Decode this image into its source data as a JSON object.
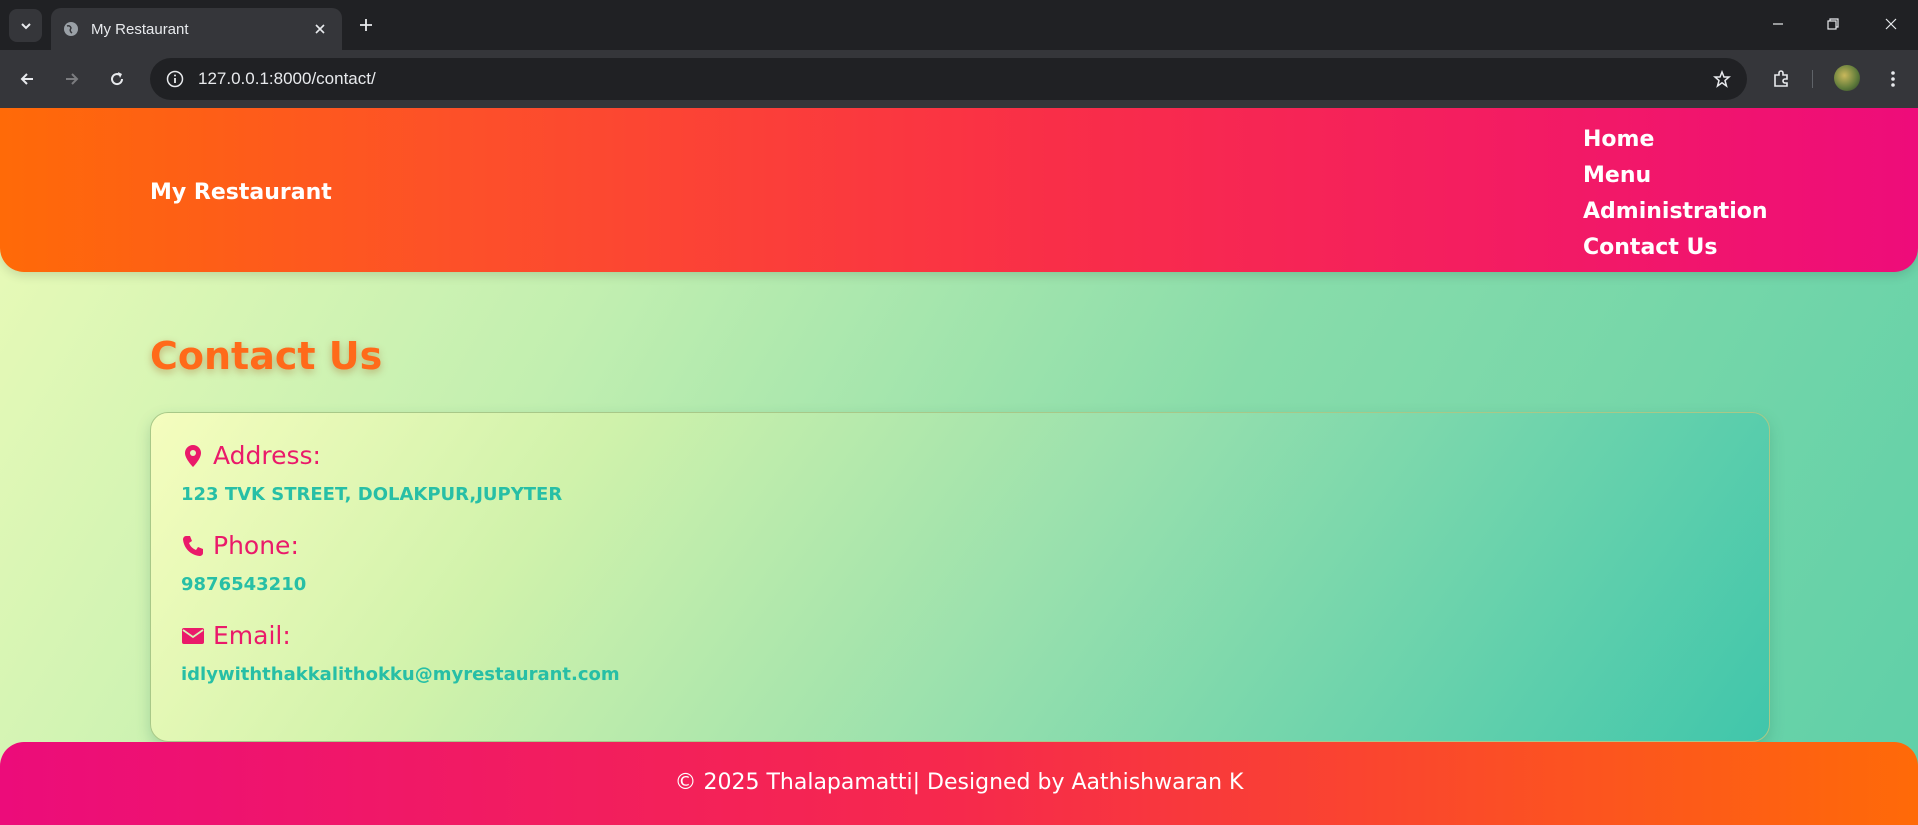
{
  "browser": {
    "tab_title": "My Restaurant",
    "url": "127.0.0.1:8000/contact/",
    "icons": [
      "tab-search-icon",
      "globe-icon",
      "close-icon",
      "plus-icon",
      "minimize-icon",
      "restore-icon",
      "close-window-icon",
      "back-icon",
      "forward-icon",
      "reload-icon",
      "info-icon",
      "star-icon",
      "extensions-icon",
      "profile-avatar",
      "more-icon"
    ]
  },
  "header": {
    "brand": "My Restaurant",
    "nav": [
      "Home",
      "Menu",
      "Administration",
      "Contact Us"
    ]
  },
  "main": {
    "title": "Contact Us",
    "address": {
      "label": "Address:",
      "value": "123 TVK STREET, DOLAKPUR,JUPYTER",
      "icon": "map-pin-icon"
    },
    "phone": {
      "label": "Phone:",
      "value": "9876543210",
      "icon": "phone-icon"
    },
    "email": {
      "label": "Email:",
      "value": "idlywiththakkalithokku@myrestaurant.com",
      "icon": "envelope-icon"
    }
  },
  "footer": {
    "text": "© 2025 Thalapamatti| Designed by Aathishwaran K"
  },
  "colors": {
    "header_gradient": [
      "#ff6a08",
      "#ee0c7a"
    ],
    "label": "#ea1a6a",
    "value": "#27bfa6",
    "title": "#ff6a1a"
  }
}
